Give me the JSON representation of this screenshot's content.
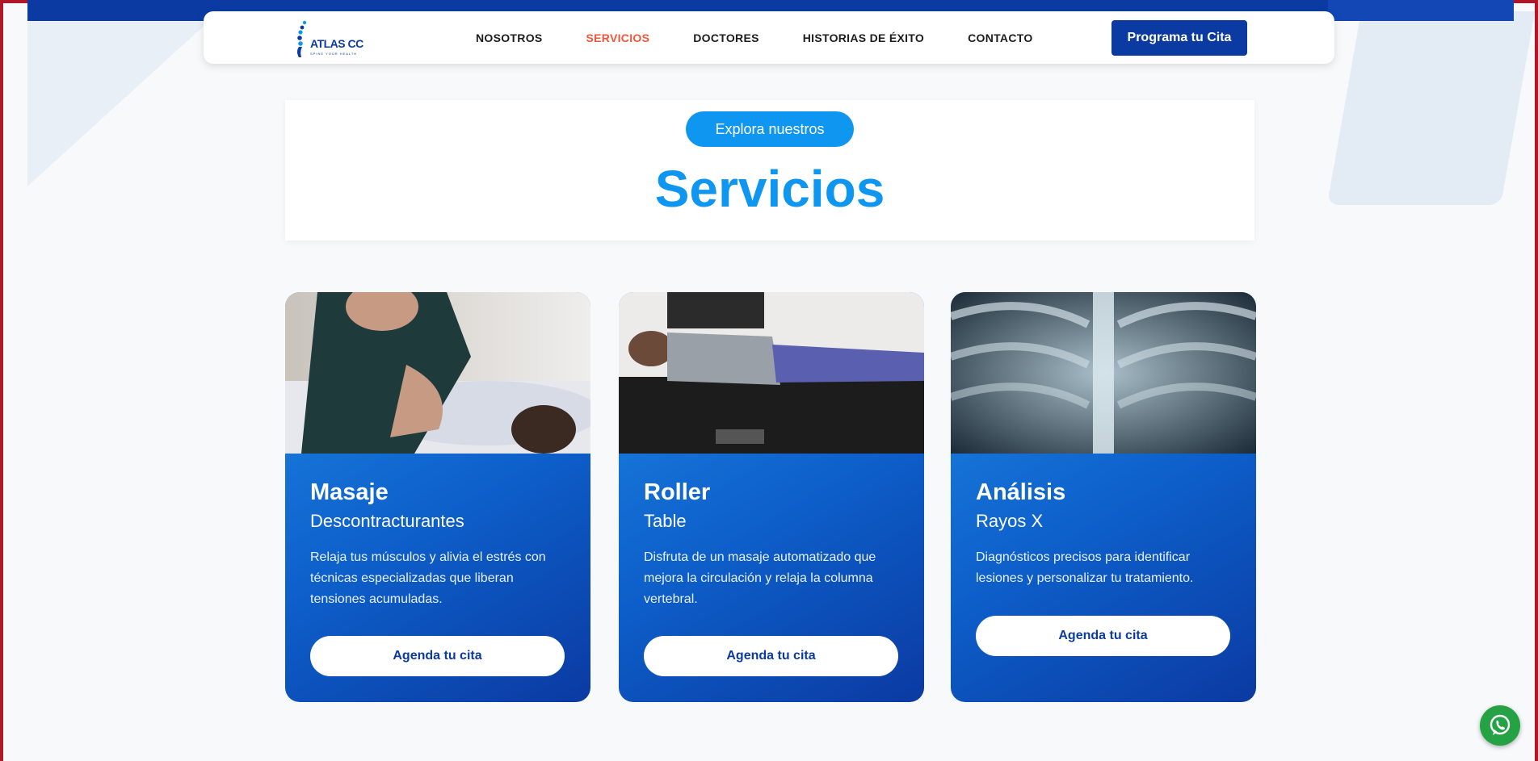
{
  "brand": {
    "name": "ATLAS CC",
    "tagline": "SPINE YOUR HEALTH"
  },
  "nav": {
    "items": [
      {
        "label": "NOSOTROS"
      },
      {
        "label": "SERVICIOS"
      },
      {
        "label": "DOCTORES"
      },
      {
        "label": "HISTORIAS DE ÉXITO"
      },
      {
        "label": "CONTACTO"
      }
    ],
    "cta": "Programa tu Cita"
  },
  "hero": {
    "pill": "Explora nuestros",
    "title": "Servicios"
  },
  "cards": [
    {
      "title": "Masaje",
      "subtitle": "Descontracturantes",
      "description": "Relaja tus músculos y alivia el estrés con técnicas especializadas que liberan tensiones acumuladas.",
      "button": "Agenda tu cita"
    },
    {
      "title": "Roller",
      "subtitle": "Table",
      "description": "Disfruta de un masaje automatizado que mejora la circulación y relaja la columna vertebral.",
      "button": "Agenda tu cita"
    },
    {
      "title": "Análisis",
      "subtitle": "Rayos X",
      "description": "Diagnósticos precisos para identificar lesiones y personalizar tu tratamiento.",
      "button": "Agenda tu cita"
    }
  ],
  "colors": {
    "primary_blue": "#0b3aa2",
    "accent_blue": "#0f96f0",
    "active_nav": "#f0553a",
    "whatsapp": "#25a244"
  },
  "icons": {
    "floating": "whatsapp-icon"
  }
}
